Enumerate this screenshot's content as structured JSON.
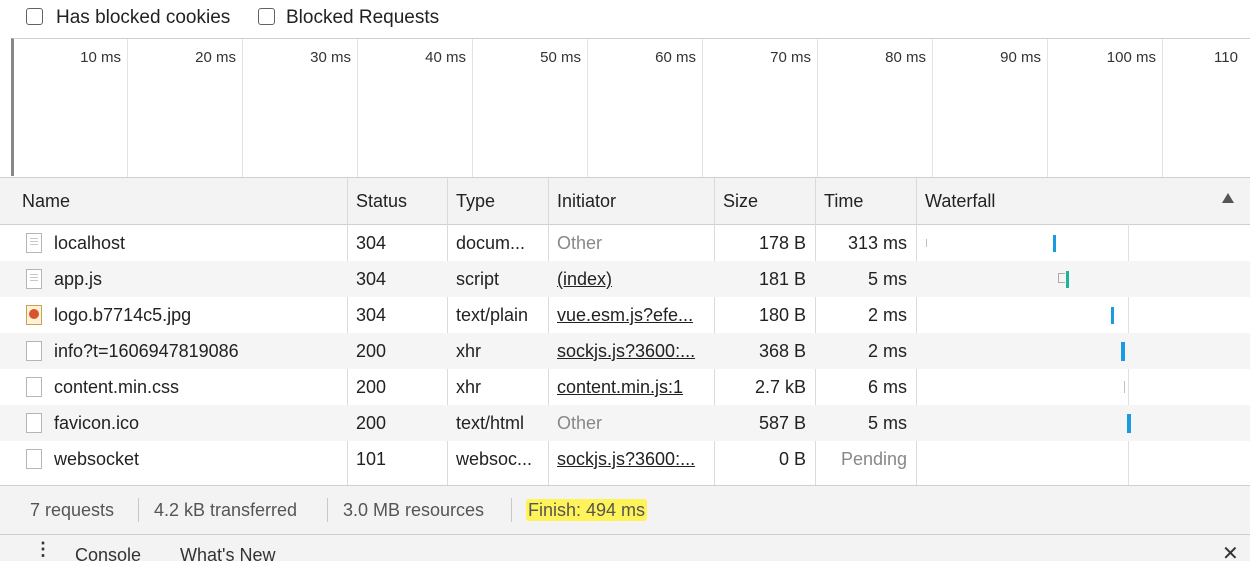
{
  "filters": {
    "blocked_cookies": {
      "label": "Has blocked cookies",
      "checked": false
    },
    "blocked_requests": {
      "label": "Blocked Requests",
      "checked": false
    }
  },
  "overview": {
    "ticks": [
      "10 ms",
      "20 ms",
      "30 ms",
      "40 ms",
      "50 ms",
      "60 ms",
      "70 ms",
      "80 ms",
      "90 ms",
      "100 ms",
      "110"
    ]
  },
  "table": {
    "columns": [
      "Name",
      "Status",
      "Type",
      "Initiator",
      "Size",
      "Time",
      "Waterfall"
    ],
    "sort_icon": "triangle-up-icon",
    "rows": [
      {
        "name": "localhost",
        "icon": "document-icon",
        "status": "304",
        "type": "docum...",
        "initiator": "Other",
        "size": "178 B",
        "time": "313 ms"
      },
      {
        "name": "app.js",
        "icon": "script-icon",
        "status": "304",
        "type": "script",
        "initiator": "(index)",
        "size": "181 B",
        "time": "5 ms"
      },
      {
        "name": "logo.b7714c5.jpg",
        "icon": "image-icon",
        "status": "304",
        "type": "text/plain",
        "initiator": "vue.esm.js?efe...",
        "size": "180 B",
        "time": "2 ms"
      },
      {
        "name": "info?t=1606947819086",
        "icon": "file-icon",
        "status": "200",
        "type": "xhr",
        "initiator": "sockjs.js?3600:...",
        "size": "368 B",
        "time": "2 ms"
      },
      {
        "name": "content.min.css",
        "icon": "file-icon",
        "status": "200",
        "type": "xhr",
        "initiator": "content.min.js:1",
        "size": "2.7 kB",
        "time": "6 ms"
      },
      {
        "name": "favicon.ico",
        "icon": "file-icon",
        "status": "200",
        "type": "text/html",
        "initiator": "Other",
        "size": "587 B",
        "time": "5 ms"
      },
      {
        "name": "websocket",
        "icon": "file-icon",
        "status": "101",
        "type": "websoc...",
        "initiator": "sockjs.js?3600:...",
        "size": "0 B",
        "time": "Pending"
      }
    ]
  },
  "status_bar": {
    "requests": "7 requests",
    "transferred": "4.2 kB transferred",
    "resources": "3.0 MB resources",
    "finish": "Finish: 494 ms"
  },
  "drawer": {
    "menu_icon": "kebab-menu-icon",
    "tabs": [
      "Console",
      "What's New"
    ],
    "close_icon": "close-icon"
  },
  "colors": {
    "waterfall_bar": "#1a9be0",
    "highlight": "#fff35a"
  }
}
